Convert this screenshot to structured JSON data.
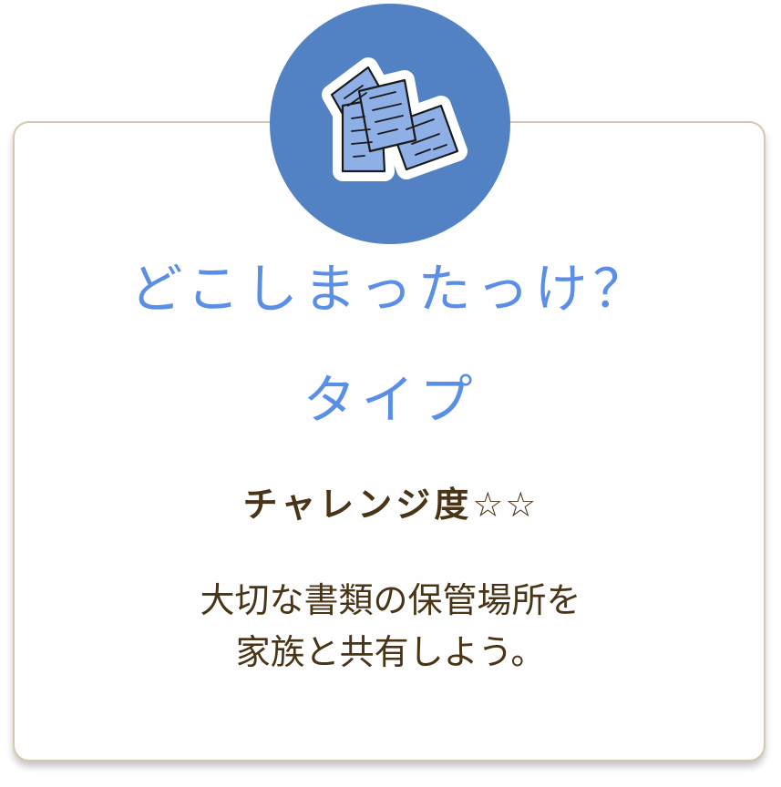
{
  "card": {
    "title_line1": "どこしまったっけ？",
    "title_line2": "タイプ",
    "challenge_label": "チャレンジ度",
    "challenge_stars": "☆☆",
    "description_line1": "大切な書類の保管場所を",
    "description_line2": "家族と共有しよう。"
  },
  "badge": {
    "icon": "documents-icon"
  },
  "colors": {
    "badge_blue": "#5282c3",
    "paper_blue": "#8fb0e6",
    "title_blue": "#5b8fe6",
    "text_brown": "#4a3416",
    "card_border": "#d6c7ad"
  }
}
